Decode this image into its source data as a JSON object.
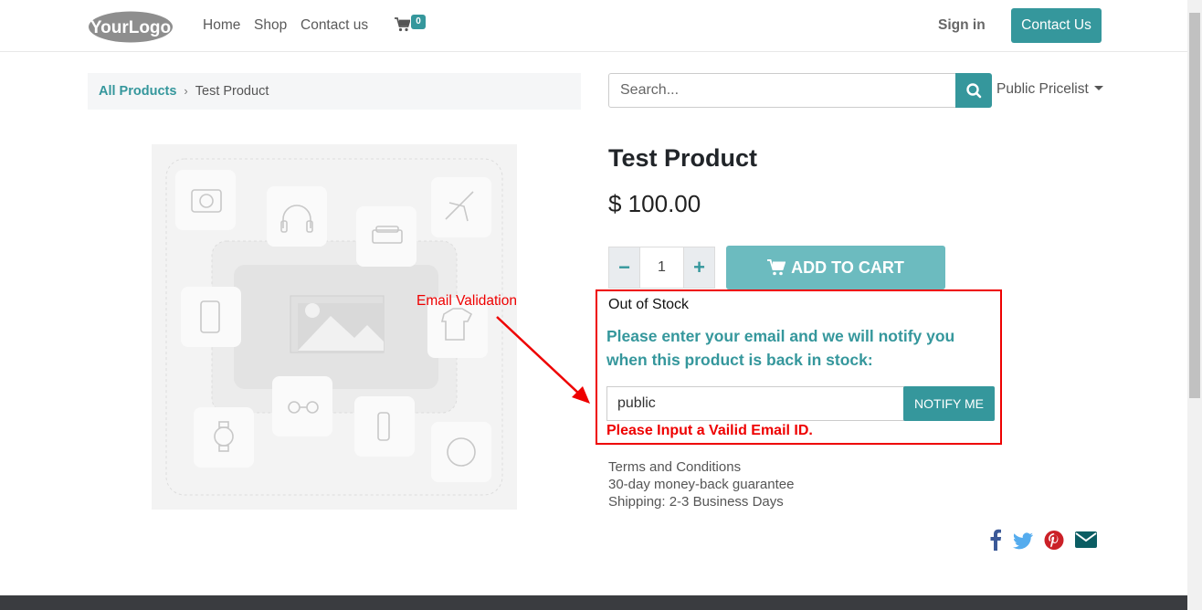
{
  "header": {
    "logo_text": "YourLogo",
    "nav": [
      "Home",
      "Shop",
      "Contact us"
    ],
    "cart_count": "0",
    "signin": "Sign in",
    "contact_button": "Contact Us"
  },
  "breadcrumb": {
    "root": "All Products",
    "current": "Test Product"
  },
  "search": {
    "placeholder": "Search...",
    "pricelist": "Public Pricelist"
  },
  "product": {
    "name": "Test Product",
    "price": "$ 100.00",
    "quantity": "1",
    "add_to_cart": "ADD TO CART"
  },
  "stock_notify": {
    "status": "Out of Stock",
    "message": "Please enter your email and we will notify you when this product is back in stock:",
    "email_value": "public",
    "notify_button": "NOTIFY ME",
    "error": "Please Input a Vailid Email ID."
  },
  "annotation": "Email Validation",
  "terms": [
    "Terms and Conditions",
    "30-day money-back guarantee",
    "Shipping: 2-3 Business Days"
  ],
  "social_icons": [
    "facebook-icon",
    "twitter-icon",
    "pinterest-icon",
    "email-icon"
  ],
  "colors": {
    "accent": "#35979c",
    "error": "#ee0000",
    "facebook": "#3b5998",
    "twitter": "#55acee",
    "pinterest": "#cb2027",
    "email": "#0b5d63"
  }
}
